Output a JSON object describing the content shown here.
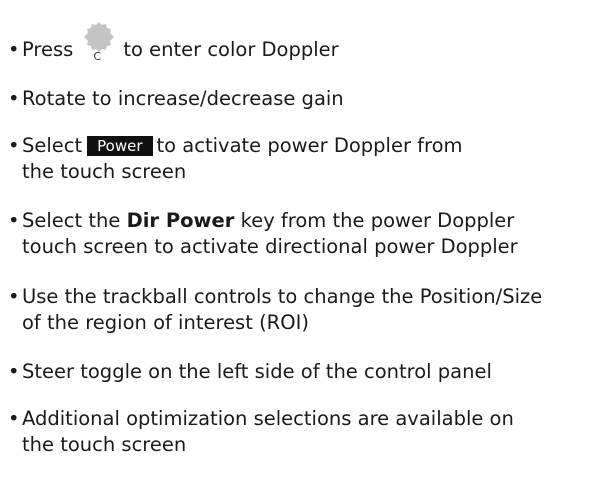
{
  "bullet_char": "•",
  "items": [
    {
      "before": "Press",
      "knob_label": "C",
      "after": "to enter color Doppler"
    },
    {
      "text": "Rotate to increase/decrease gain"
    },
    {
      "before": "Select",
      "button_label": "Power",
      "after": "to activate power Doppler from",
      "line2": "the touch screen"
    },
    {
      "before": "Select the",
      "bold": "Dir Power",
      "after": "key from the power Doppler",
      "line2": "touch screen to activate directional power Doppler"
    },
    {
      "line1": "Use the trackball controls to change the Position/Size",
      "line2": "of the region of interest (ROI)"
    },
    {
      "text": "Steer toggle on the left side of the control panel"
    },
    {
      "line1": "Additional optimization selections are available on",
      "line2": "the touch screen"
    }
  ],
  "colors": {
    "knob": "#c4c4c4",
    "button_bg": "#111111",
    "button_text": "#ffffff",
    "text": "#1a1a1a"
  }
}
